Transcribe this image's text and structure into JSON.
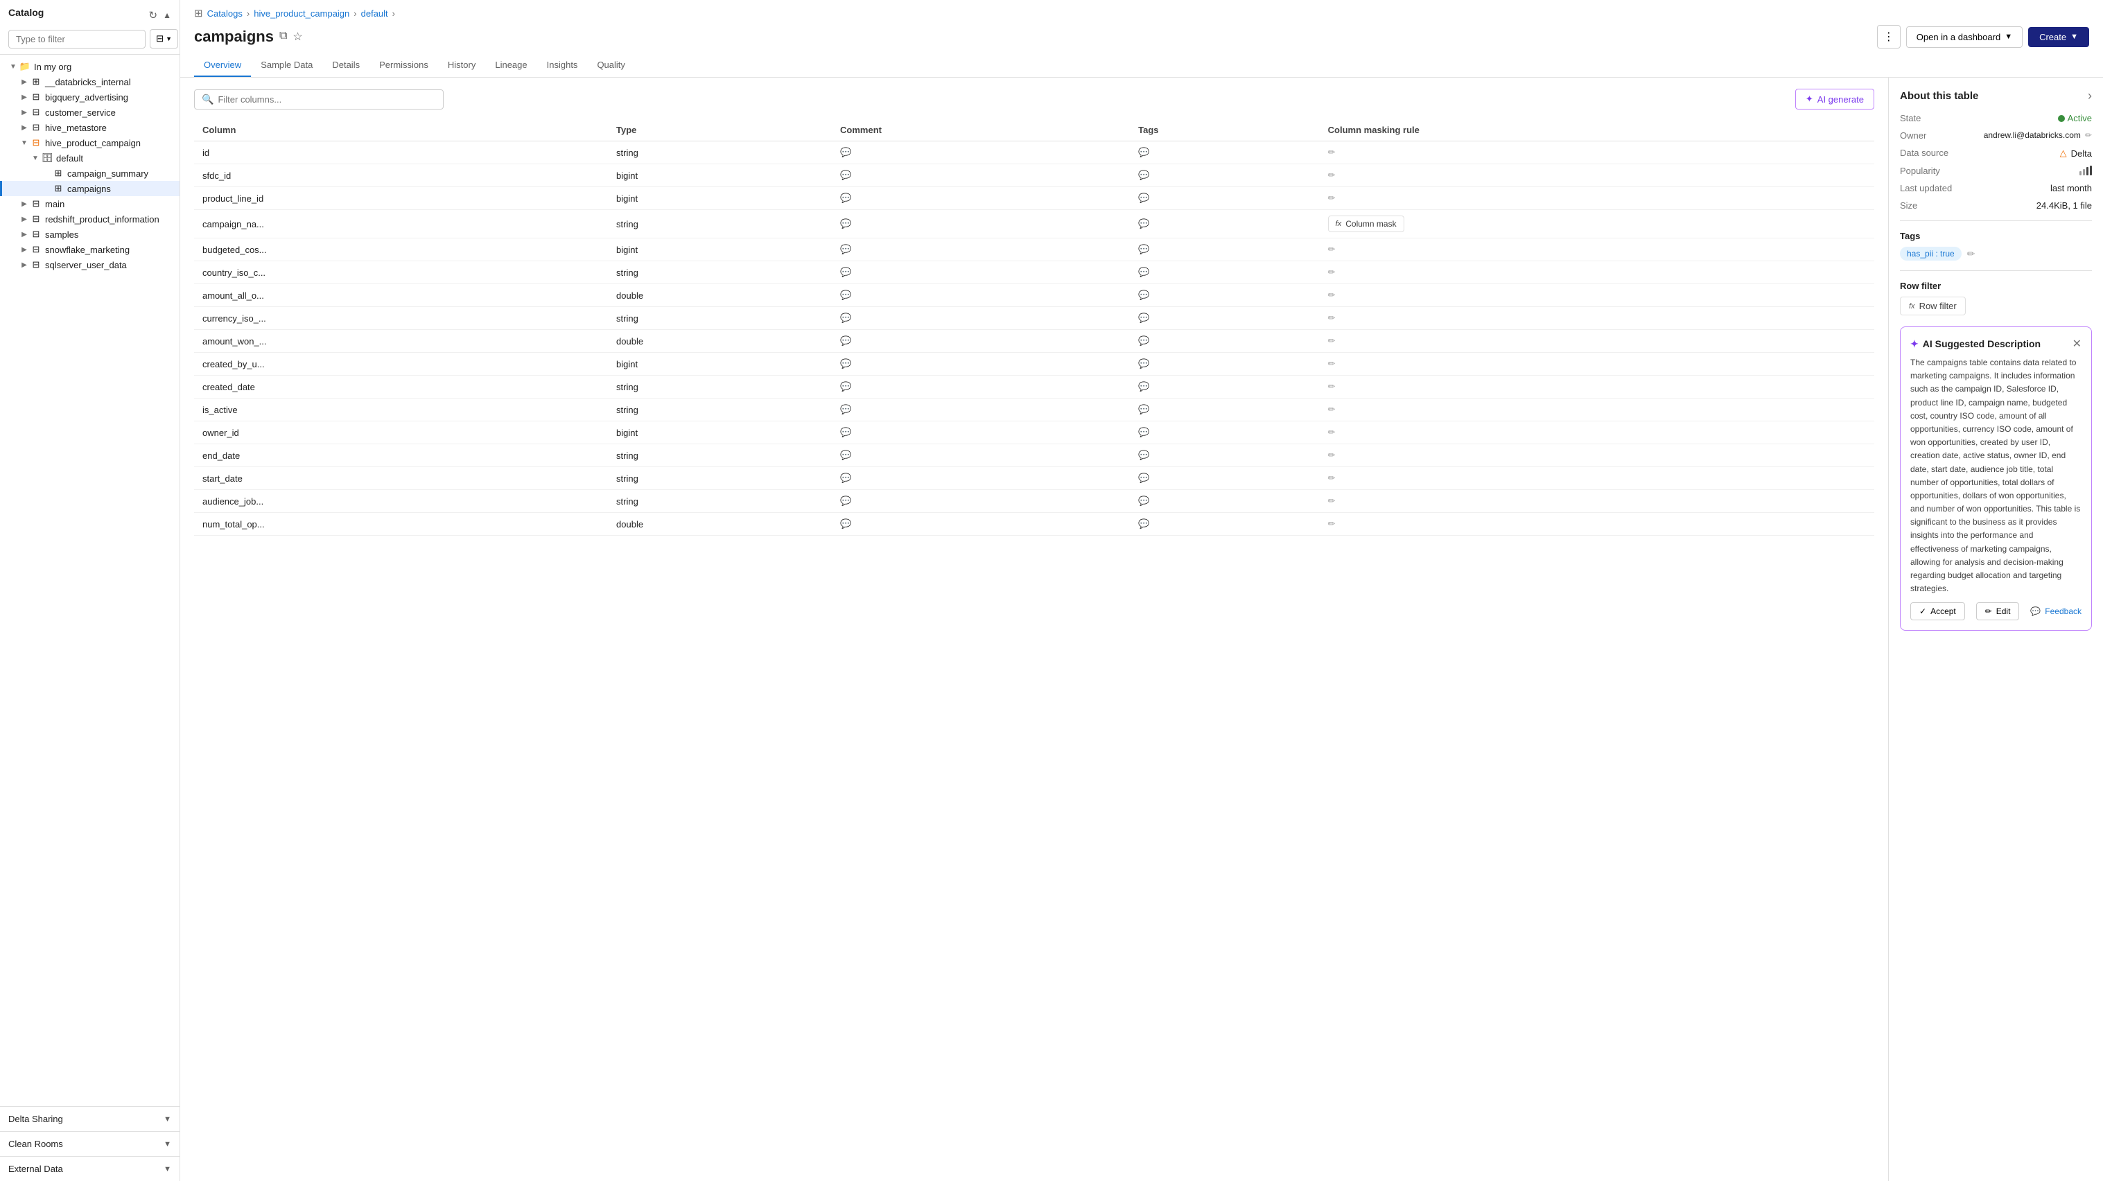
{
  "sidebar": {
    "title": "Catalog",
    "search_placeholder": "Type to filter",
    "tree": [
      {
        "id": "in_my_org",
        "label": "In my org",
        "level": 0,
        "expanded": true,
        "icon": "folder",
        "hasChildren": true
      },
      {
        "id": "__databricks_internal",
        "label": "__databricks_internal",
        "level": 1,
        "expanded": false,
        "icon": "table",
        "hasChildren": true
      },
      {
        "id": "bigquery_advertising",
        "label": "bigquery_advertising",
        "level": 1,
        "expanded": false,
        "icon": "catalog",
        "hasChildren": true
      },
      {
        "id": "customer_service",
        "label": "customer_service",
        "level": 1,
        "expanded": false,
        "icon": "catalog",
        "hasChildren": true
      },
      {
        "id": "hive_metastore",
        "label": "hive_metastore",
        "level": 1,
        "expanded": false,
        "icon": "catalog",
        "hasChildren": true
      },
      {
        "id": "hive_product_campaign",
        "label": "hive_product_campaign",
        "level": 1,
        "expanded": true,
        "icon": "catalog_special",
        "hasChildren": true
      },
      {
        "id": "default",
        "label": "default",
        "level": 2,
        "expanded": true,
        "icon": "schema",
        "hasChildren": true
      },
      {
        "id": "campaign_summary",
        "label": "campaign_summary",
        "level": 3,
        "expanded": false,
        "icon": "table",
        "hasChildren": false
      },
      {
        "id": "campaigns",
        "label": "campaigns",
        "level": 3,
        "expanded": false,
        "icon": "table",
        "hasChildren": false,
        "selected": true
      },
      {
        "id": "main",
        "label": "main",
        "level": 1,
        "expanded": false,
        "icon": "catalog",
        "hasChildren": true
      },
      {
        "id": "redshift_product_information",
        "label": "redshift_product_information",
        "level": 1,
        "expanded": false,
        "icon": "catalog",
        "hasChildren": true
      },
      {
        "id": "samples",
        "label": "samples",
        "level": 1,
        "expanded": false,
        "icon": "catalog",
        "hasChildren": true
      },
      {
        "id": "snowflake_marketing",
        "label": "snowflake_marketing",
        "level": 1,
        "expanded": false,
        "icon": "catalog",
        "hasChildren": true
      },
      {
        "id": "sqlserver_user_data",
        "label": "sqlserver_user_data",
        "level": 1,
        "expanded": false,
        "icon": "catalog",
        "hasChildren": true
      }
    ],
    "sections": [
      {
        "id": "delta_sharing",
        "label": "Delta Sharing",
        "expanded": false
      },
      {
        "id": "clean_rooms",
        "label": "Clean Rooms",
        "expanded": false
      },
      {
        "id": "external_data",
        "label": "External Data",
        "expanded": false
      }
    ]
  },
  "breadcrumb": {
    "items": [
      "Catalogs",
      "hive_product_campaign",
      "default"
    ],
    "separator": "›"
  },
  "page": {
    "title": "campaigns",
    "copy_label": "copy",
    "favorite_label": "favorite",
    "table_icon": "table"
  },
  "header_actions": {
    "more_label": "⋮",
    "open_dashboard_label": "Open in a dashboard",
    "create_label": "Create"
  },
  "tabs": [
    {
      "id": "overview",
      "label": "Overview",
      "active": true
    },
    {
      "id": "sample_data",
      "label": "Sample Data",
      "active": false
    },
    {
      "id": "details",
      "label": "Details",
      "active": false
    },
    {
      "id": "permissions",
      "label": "Permissions",
      "active": false
    },
    {
      "id": "history",
      "label": "History",
      "active": false
    },
    {
      "id": "lineage",
      "label": "Lineage",
      "active": false
    },
    {
      "id": "insights",
      "label": "Insights",
      "active": false
    },
    {
      "id": "quality",
      "label": "Quality",
      "active": false
    }
  ],
  "filter": {
    "placeholder": "Filter columns..."
  },
  "ai_generate": {
    "label": "AI generate"
  },
  "table": {
    "columns": [
      "Column",
      "Type",
      "Comment",
      "Tags",
      "Column masking rule"
    ],
    "rows": [
      {
        "name": "id",
        "type": "string",
        "mask": "pencil"
      },
      {
        "name": "sfdc_id",
        "type": "bigint",
        "mask": "pencil"
      },
      {
        "name": "product_line_id",
        "type": "bigint",
        "mask": "pencil"
      },
      {
        "name": "campaign_na...",
        "type": "string",
        "mask": "column_mask",
        "mask_label": "Column mask"
      },
      {
        "name": "budgeted_cos...",
        "type": "bigint",
        "mask": "pencil"
      },
      {
        "name": "country_iso_c...",
        "type": "string",
        "mask": "pencil"
      },
      {
        "name": "amount_all_o...",
        "type": "double",
        "mask": "pencil"
      },
      {
        "name": "currency_iso_...",
        "type": "string",
        "mask": "pencil"
      },
      {
        "name": "amount_won_...",
        "type": "double",
        "mask": "pencil"
      },
      {
        "name": "created_by_u...",
        "type": "bigint",
        "mask": "pencil"
      },
      {
        "name": "created_date",
        "type": "string",
        "mask": "pencil"
      },
      {
        "name": "is_active",
        "type": "string",
        "mask": "pencil"
      },
      {
        "name": "owner_id",
        "type": "bigint",
        "mask": "pencil"
      },
      {
        "name": "end_date",
        "type": "string",
        "mask": "pencil"
      },
      {
        "name": "start_date",
        "type": "string",
        "mask": "pencil"
      },
      {
        "name": "audience_job...",
        "type": "string",
        "mask": "pencil"
      },
      {
        "name": "num_total_op...",
        "type": "double",
        "mask": "pencil"
      }
    ]
  },
  "right_panel": {
    "title": "About this table",
    "expand_label": "expand",
    "rows": [
      {
        "label": "State",
        "value": "Active",
        "type": "badge"
      },
      {
        "label": "Owner",
        "value": "andrew.li@databricks.com",
        "type": "email"
      },
      {
        "label": "Data source",
        "value": "Delta",
        "type": "delta"
      },
      {
        "label": "Popularity",
        "value": "popularity",
        "type": "bars"
      },
      {
        "label": "Last updated",
        "value": "last month",
        "type": "text"
      },
      {
        "label": "Size",
        "value": "24.4KiB, 1 file",
        "type": "text"
      }
    ],
    "tags": {
      "label": "Tags",
      "items": [
        "has_pii : true"
      ]
    },
    "row_filter": {
      "label": "Row filter",
      "button_label": "Row filter"
    }
  },
  "ai_suggestion": {
    "title": "AI Suggested Description",
    "text": "The campaigns table contains data related to marketing campaigns. It includes information such as the campaign ID, Salesforce ID, product line ID, campaign name, budgeted cost, country ISO code, amount of all opportunities, currency ISO code, amount of won opportunities, created by user ID, creation date, active status, owner ID, end date, start date, audience job title, total number of opportunities, total dollars of opportunities, dollars of won opportunities, and number of won opportunities. This table is significant to the business as it provides insights into the performance and effectiveness of marketing campaigns, allowing for analysis and decision-making regarding budget allocation and targeting strategies.",
    "accept_label": "Accept",
    "edit_label": "Edit",
    "feedback_label": "Feedback"
  }
}
